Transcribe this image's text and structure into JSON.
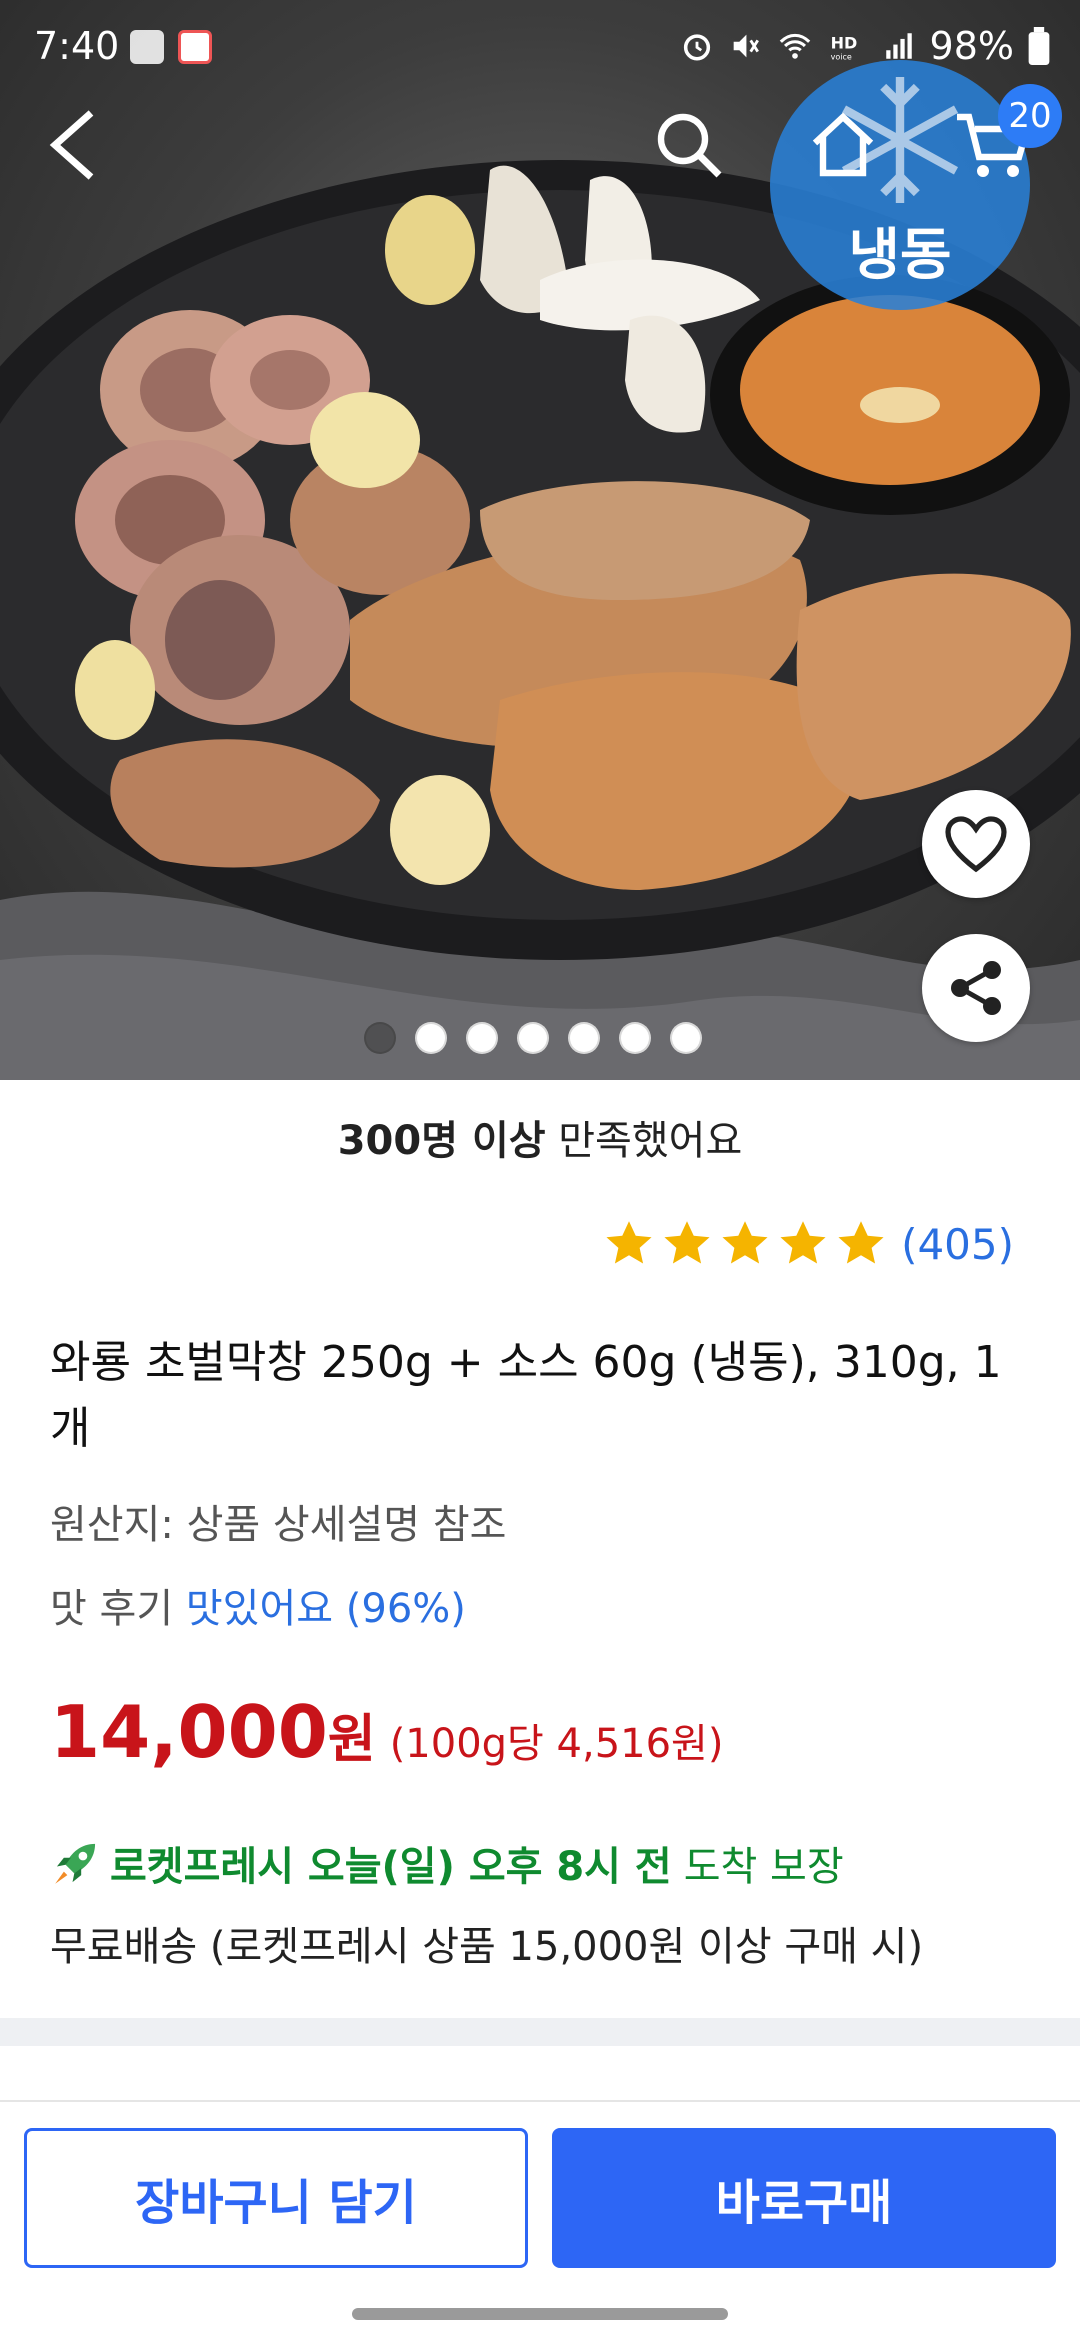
{
  "status_bar": {
    "time": "7:40",
    "battery": "98%",
    "right_icons": [
      "alarm-icon",
      "mute-icon",
      "wifi-icon",
      "hd-voice-icon",
      "signal-icon",
      "battery-icon"
    ]
  },
  "nav": {
    "icons": [
      "back-icon",
      "search-icon",
      "home-icon",
      "cart-icon"
    ],
    "cart_count": "20",
    "freeze_badge": "냉동"
  },
  "gallery": {
    "total_images": 7,
    "active_index": 0
  },
  "product": {
    "satisfied_bold": "300명 이상",
    "satisfied_rest": " 만족했어요",
    "rating_stars": 5,
    "review_count": "(405)",
    "title": "와룡 초벌막창 250g + 소스 60g (냉동), 310g, 1개",
    "origin": "원산지: 상품 상세설명 참조",
    "taste_label": "맛 후기 ",
    "taste_value": "맛있어요 (96%)",
    "price": "14,000",
    "price_unit": "원",
    "unit_price": "(100g당 4,516원)",
    "delivery_bold": "로켓프레시 오늘(일) 오후 8시 전",
    "delivery_rest": "도착 보장",
    "free_shipping": "무료배송 (로켓프레시 상품 15,000원 이상 구매 시)"
  },
  "actions": {
    "add_to_cart": "장바구니 담기",
    "buy_now": "바로구매"
  },
  "colors": {
    "accent_blue": "#2d66f5",
    "price_red": "#c8141a",
    "rocket_green": "#0f8a2f",
    "star_gold": "#f5b400"
  }
}
